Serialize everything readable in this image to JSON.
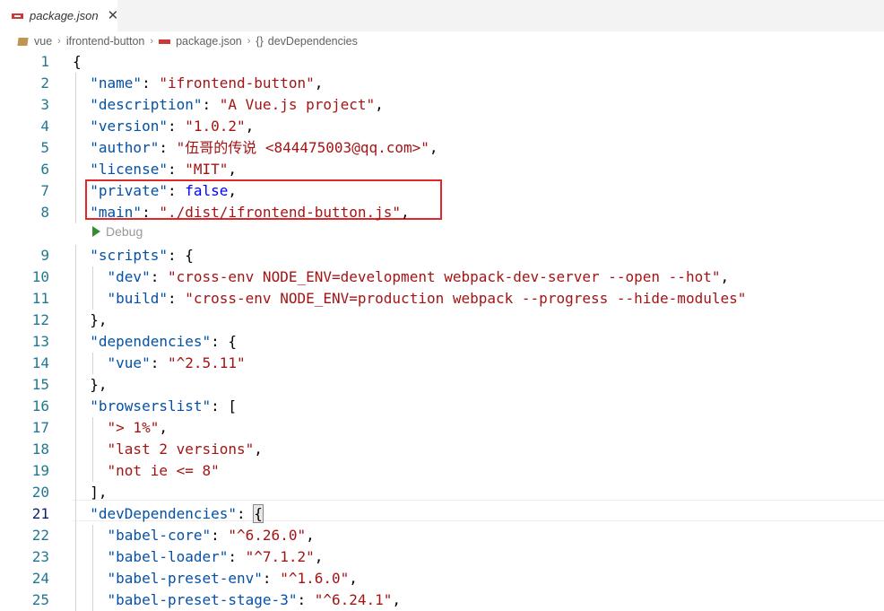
{
  "tab": {
    "title": "package.json",
    "close": "✕",
    "icon": "npm-file-icon"
  },
  "breadcrumb": {
    "items": [
      "vue",
      "ifrontend-button",
      "package.json",
      "devDependencies"
    ],
    "separator": "›",
    "braces": "{}"
  },
  "codelens": {
    "label": "Debug"
  },
  "lines": [
    {
      "n": "1",
      "text": "{"
    },
    {
      "n": "2",
      "text": "  \"name\": \"ifrontend-button\","
    },
    {
      "n": "3",
      "text": "  \"description\": \"A Vue.js project\","
    },
    {
      "n": "4",
      "text": "  \"version\": \"1.0.2\","
    },
    {
      "n": "5",
      "text": "  \"author\": \"伍哥的传说 <844475003@qq.com>\","
    },
    {
      "n": "6",
      "text": "  \"license\": \"MIT\","
    },
    {
      "n": "7",
      "text": "  \"private\": false,"
    },
    {
      "n": "8",
      "text": "  \"main\": \"./dist/ifrontend-button.js\","
    },
    {
      "n": "9",
      "text": "  \"scripts\": {"
    },
    {
      "n": "10",
      "text": "    \"dev\": \"cross-env NODE_ENV=development webpack-dev-server --open --hot\","
    },
    {
      "n": "11",
      "text": "    \"build\": \"cross-env NODE_ENV=production webpack --progress --hide-modules\""
    },
    {
      "n": "12",
      "text": "  },"
    },
    {
      "n": "13",
      "text": "  \"dependencies\": {"
    },
    {
      "n": "14",
      "text": "    \"vue\": \"^2.5.11\""
    },
    {
      "n": "15",
      "text": "  },"
    },
    {
      "n": "16",
      "text": "  \"browserslist\": ["
    },
    {
      "n": "17",
      "text": "    \"> 1%\","
    },
    {
      "n": "18",
      "text": "    \"last 2 versions\","
    },
    {
      "n": "19",
      "text": "    \"not ie <= 8\""
    },
    {
      "n": "20",
      "text": "  ],"
    },
    {
      "n": "21",
      "text": "  \"devDependencies\": {"
    },
    {
      "n": "22",
      "text": "    \"babel-core\": \"^6.26.0\","
    },
    {
      "n": "23",
      "text": "    \"babel-loader\": \"^7.1.2\","
    },
    {
      "n": "24",
      "text": "    \"babel-preset-env\": \"^1.6.0\","
    },
    {
      "n": "25",
      "text": "    \"babel-preset-stage-3\": \"^6.24.1\","
    }
  ],
  "active_line": "21",
  "colors": {
    "key": "#0451a5",
    "string": "#a31515",
    "keyword": "#0000ff",
    "line_number": "#237893",
    "highlight_border": "#e0282a"
  }
}
